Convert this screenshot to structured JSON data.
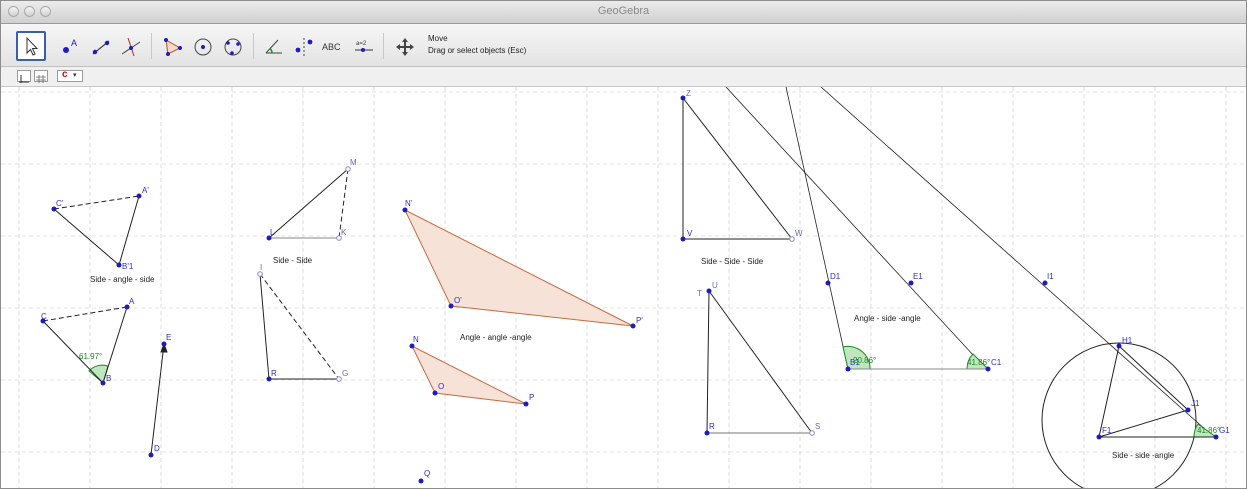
{
  "window": {
    "title": "GeoGebra"
  },
  "toolbar": {
    "tools": [
      {
        "name": "move-tool-button",
        "icon": "cursor-arrow-icon"
      },
      {
        "name": "point-tool-button",
        "icon": "point-icon",
        "glyph": "A"
      },
      {
        "name": "line-tool-button",
        "icon": "line-icon"
      },
      {
        "name": "perpendicular-tool-button",
        "icon": "perpendicular-icon"
      },
      {
        "name": "polygon-tool-button",
        "icon": "polygon-icon"
      },
      {
        "name": "circle-tool-button",
        "icon": "circle-icon"
      },
      {
        "name": "circle-three-points-tool-button",
        "icon": "circle-three-points-icon"
      },
      {
        "name": "angle-tool-button",
        "icon": "angle-icon"
      },
      {
        "name": "reflect-tool-button",
        "icon": "reflect-icon"
      },
      {
        "name": "text-tool-button",
        "icon": "text-icon",
        "glyph": "ABC"
      },
      {
        "name": "slider-tool-button",
        "icon": "slider-icon",
        "glyph": "a=2"
      },
      {
        "name": "move-view-tool-button",
        "icon": "move-view-icon"
      }
    ],
    "active_tool_title": "Move",
    "active_tool_desc": "Drag or select objects (Esc)"
  },
  "stylebar": {
    "color_button": "c"
  },
  "colors": {
    "point": "#1c1cc0",
    "label": "#2b2bd6",
    "polygon_fill": "#f6e2d6",
    "polygon_stroke": "#c86a40",
    "angle": "#1a8a1a",
    "angle_fill": "#bfe6bf",
    "grid": "#c8c8c8"
  },
  "canvas": {
    "captions": {
      "sas": "Side - angle - side",
      "ss": "Side - Side",
      "aaa": "Angle - angle -angle",
      "sss": "Side - Side - Side",
      "asa": "Angle - side -angle",
      "ssa": "Side - side -angle"
    },
    "angles": {
      "b": "61.97°",
      "b1": "20.86°",
      "c1": "41.86°",
      "g1": "41.86°"
    },
    "points": {
      "c_prime": "C'",
      "a_prime": "A'",
      "b_prime_1": "B'1",
      "c": "C",
      "a": "A",
      "b": "B",
      "e": "E",
      "d": "D",
      "m": "M",
      "l": "L",
      "k": "K",
      "i": "I",
      "r_left": "R",
      "g": "G",
      "n_prime": "N'",
      "o_prime": "O'",
      "p_prime": "P'",
      "n": "N",
      "o": "O",
      "p": "P",
      "q": "Q",
      "z": "Z",
      "v": "V",
      "w": "W",
      "t": "T",
      "u": "U",
      "r": "R",
      "s": "S",
      "d1": "D1",
      "e1": "E1",
      "b1": "B1",
      "c1": "C1",
      "i1": "I1",
      "h1": "H1",
      "j1": "J1",
      "f1": "F1",
      "g1": "G1"
    }
  }
}
